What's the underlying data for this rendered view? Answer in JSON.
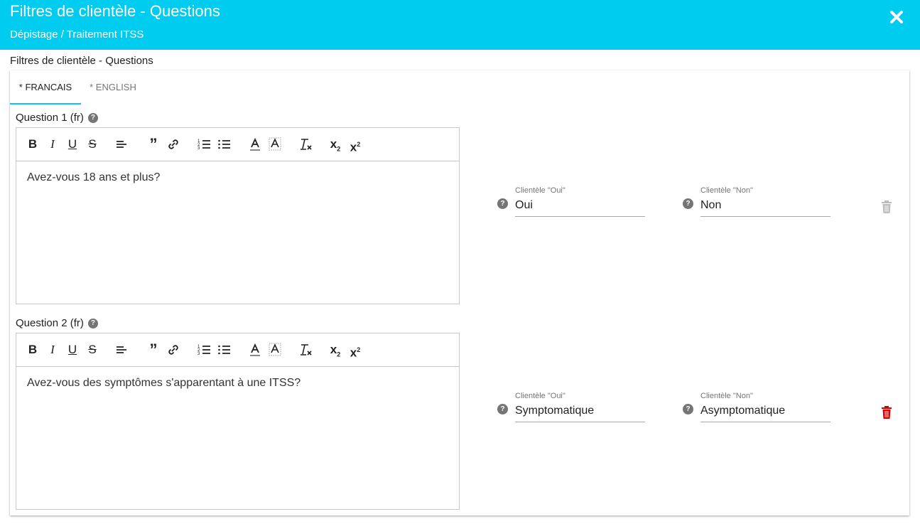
{
  "header": {
    "title": "Filtres de clientèle - Questions",
    "subtitle": "Dépistage / Traitement ITSS"
  },
  "section_label": "Filtres de clientèle - Questions",
  "tabs": [
    {
      "label": "* FRANCAIS",
      "active": true
    },
    {
      "label": "* ENGLISH",
      "active": false
    }
  ],
  "toolbar": {
    "subscript_label": "x",
    "subscript_sub": "2",
    "superscript_label": "x",
    "superscript_sup": "2"
  },
  "questions": [
    {
      "label": "Question 1 (fr)",
      "text": "Avez-vous 18 ans et plus?",
      "yes_label": "Clientèle \"Oui\"",
      "yes_value": "Oui",
      "no_label": "Clientèle \"Non\"",
      "no_value": "Non",
      "delete_enabled": false
    },
    {
      "label": "Question 2 (fr)",
      "text": "Avez-vous des symptômes s'apparentant à une ITSS?",
      "yes_label": "Clientèle \"Oui\"",
      "yes_value": "Symptomatique",
      "no_label": "Clientèle \"Non\"",
      "no_value": "Asymptomatique",
      "delete_enabled": true
    }
  ],
  "colors": {
    "header_bg": "#00ccef",
    "tab_indicator": "#00ccef",
    "delete_active": "#d50000",
    "delete_disabled": "#bdbdbd"
  },
  "icons": [
    "close-icon",
    "help-icon",
    "bold-icon",
    "italic-icon",
    "underline-icon",
    "strikethrough-icon",
    "align-icon",
    "quote-icon",
    "link-icon",
    "ordered-list-icon",
    "bullet-list-icon",
    "text-color-icon",
    "background-color-icon",
    "clear-format-icon",
    "subscript-icon",
    "superscript-icon",
    "trash-icon"
  ]
}
